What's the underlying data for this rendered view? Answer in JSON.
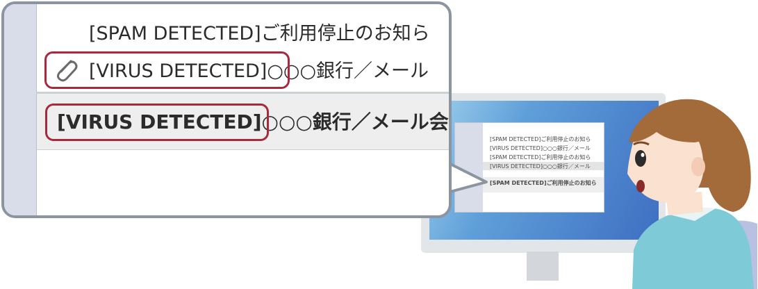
{
  "callout": {
    "rows": [
      {
        "text": "[SPAM DETECTED]ご利用停止のお知ら"
      },
      {
        "text": "[VIRUS DETECTED]○○○銀行／メール"
      },
      {
        "text": "[VIRUS DETECTED]○○○銀行／メール会"
      }
    ],
    "highlight_color": "#a8283d"
  },
  "monitor_list": {
    "lines": [
      "[SPAM DETECTED]ご利用停止のお知ら",
      "[VIRUS DETECTED]○○○銀行／メール",
      "[SPAM DETECTED]ご利用停止のお知ら",
      "[VIRUS DETECTED]○○○銀行／メール",
      "[SPAM DETECTED]ご利用停止のお知ら"
    ]
  },
  "icons": {
    "attachment": "paperclip-icon"
  },
  "colors": {
    "screen": "#3e6fc2",
    "highlight": "#a8283d",
    "skin": "#fbe1d0",
    "hair": "#a36a3a",
    "shirt": "#7ecbd7"
  }
}
